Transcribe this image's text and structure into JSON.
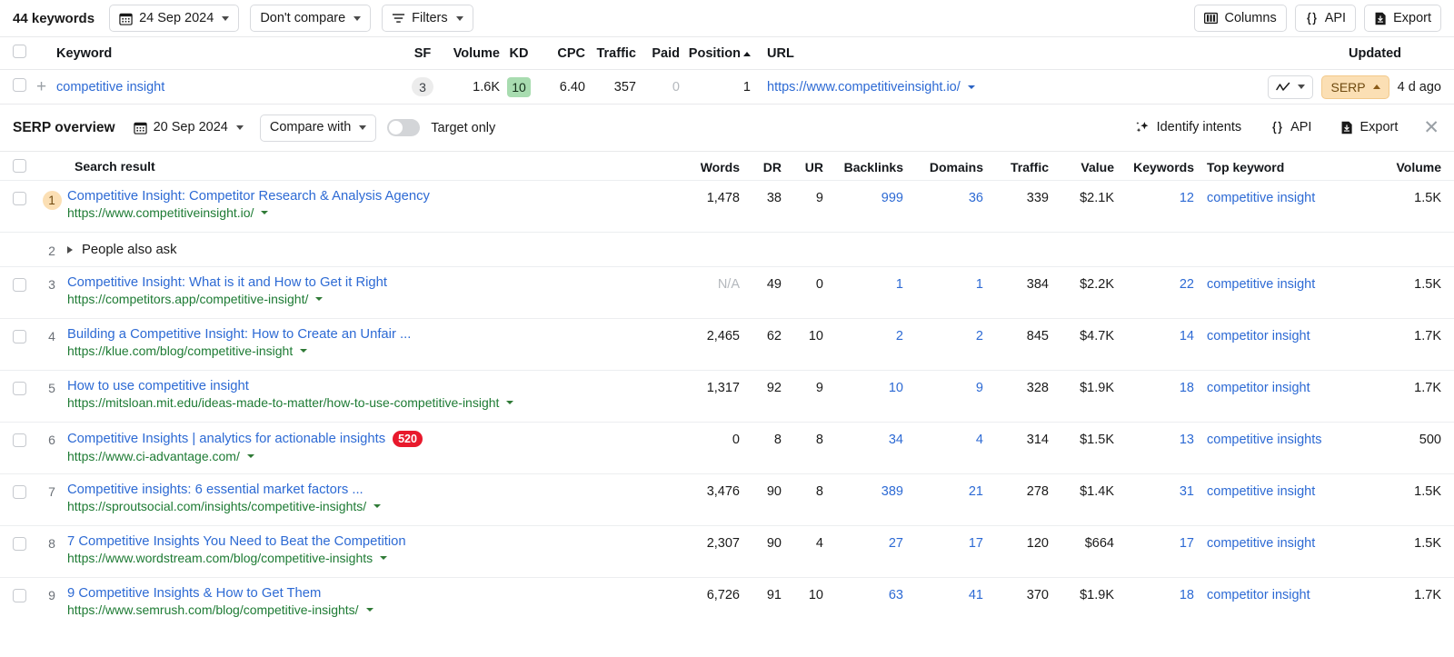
{
  "toolbar": {
    "keyword_count": "44 keywords",
    "date": "24 Sep 2024",
    "compare": "Don't compare",
    "filters": "Filters",
    "columns": "Columns",
    "api": "API",
    "export": "Export"
  },
  "keyword_table": {
    "headers": {
      "keyword": "Keyword",
      "sf": "SF",
      "volume": "Volume",
      "kd": "KD",
      "cpc": "CPC",
      "traffic": "Traffic",
      "paid": "Paid",
      "position": "Position",
      "url": "URL",
      "updated": "Updated"
    },
    "row": {
      "keyword": "competitive insight",
      "sf": "3",
      "volume": "1.6K",
      "kd": "10",
      "cpc": "6.40",
      "traffic": "357",
      "paid": "0",
      "position": "1",
      "url": "https://www.competitiveinsight.io/",
      "serp_label": "SERP",
      "updated": "4 d ago"
    }
  },
  "serp_overview": {
    "title": "SERP overview",
    "date": "20 Sep 2024",
    "compare_with": "Compare with",
    "target_only": "Target only",
    "identify_intents": "Identify intents",
    "api": "API",
    "export": "Export"
  },
  "serp_table": {
    "headers": {
      "search_result": "Search result",
      "words": "Words",
      "dr": "DR",
      "ur": "UR",
      "backlinks": "Backlinks",
      "domains": "Domains",
      "traffic": "Traffic",
      "value": "Value",
      "keywords": "Keywords",
      "top_keyword": "Top keyword",
      "volume": "Volume"
    },
    "rows": [
      {
        "type": "result",
        "rank": "1",
        "rank_highlight": true,
        "title": "Competitive Insight: Competitor Research & Analysis Agency",
        "url": "https://www.competitiveinsight.io/",
        "badge": "",
        "words": "1,478",
        "dr": "38",
        "ur": "9",
        "backlinks": "999",
        "domains": "36",
        "traffic": "339",
        "value": "$2.1K",
        "keywords": "12",
        "top_keyword": "competitive insight",
        "volume": "1.5K"
      },
      {
        "type": "paa",
        "rank": "2",
        "label": "People also ask"
      },
      {
        "type": "result",
        "rank": "3",
        "rank_highlight": false,
        "title": "Competitive Insight: What is it and How to Get it Right",
        "url": "https://competitors.app/competitive-insight/",
        "badge": "",
        "words": "N/A",
        "words_muted": true,
        "dr": "49",
        "ur": "0",
        "backlinks": "1",
        "domains": "1",
        "traffic": "384",
        "value": "$2.2K",
        "keywords": "22",
        "top_keyword": "competitive insight",
        "volume": "1.5K"
      },
      {
        "type": "result",
        "rank": "4",
        "rank_highlight": false,
        "title": "Building a Competitive Insight: How to Create an Unfair ...",
        "url": "https://klue.com/blog/competitive-insight",
        "badge": "",
        "words": "2,465",
        "dr": "62",
        "ur": "10",
        "backlinks": "2",
        "domains": "2",
        "traffic": "845",
        "value": "$4.7K",
        "keywords": "14",
        "top_keyword": "competitor insight",
        "volume": "1.7K"
      },
      {
        "type": "result",
        "rank": "5",
        "rank_highlight": false,
        "title": "How to use competitive insight",
        "url": "https://mitsloan.mit.edu/ideas-made-to-matter/how-to-use-competitive-insight",
        "badge": "",
        "words": "1,317",
        "dr": "92",
        "ur": "9",
        "backlinks": "10",
        "domains": "9",
        "traffic": "328",
        "value": "$1.9K",
        "keywords": "18",
        "top_keyword": "competitor insight",
        "volume": "1.7K"
      },
      {
        "type": "result",
        "rank": "6",
        "rank_highlight": false,
        "title": "Competitive Insights | analytics for actionable insights",
        "url": "https://www.ci-advantage.com/",
        "badge": "520",
        "words": "0",
        "dr": "8",
        "ur": "8",
        "backlinks": "34",
        "domains": "4",
        "traffic": "314",
        "value": "$1.5K",
        "keywords": "13",
        "top_keyword": "competitive insights",
        "volume": "500"
      },
      {
        "type": "result",
        "rank": "7",
        "rank_highlight": false,
        "title": "Competitive insights: 6 essential market factors ...",
        "url": "https://sproutsocial.com/insights/competitive-insights/",
        "badge": "",
        "words": "3,476",
        "dr": "90",
        "ur": "8",
        "backlinks": "389",
        "domains": "21",
        "traffic": "278",
        "value": "$1.4K",
        "keywords": "31",
        "top_keyword": "competitive insight",
        "volume": "1.5K"
      },
      {
        "type": "result",
        "rank": "8",
        "rank_highlight": false,
        "title": "7 Competitive Insights You Need to Beat the Competition",
        "url": "https://www.wordstream.com/blog/competitive-insights",
        "badge": "",
        "words": "2,307",
        "dr": "90",
        "ur": "4",
        "backlinks": "27",
        "domains": "17",
        "traffic": "120",
        "value": "$664",
        "keywords": "17",
        "top_keyword": "competitive insight",
        "volume": "1.5K"
      },
      {
        "type": "result",
        "rank": "9",
        "rank_highlight": false,
        "title": "9 Competitive Insights & How to Get Them",
        "url": "https://www.semrush.com/blog/competitive-insights/",
        "badge": "",
        "words": "6,726",
        "dr": "91",
        "ur": "10",
        "backlinks": "63",
        "domains": "41",
        "traffic": "370",
        "value": "$1.9K",
        "keywords": "18",
        "top_keyword": "competitor insight",
        "volume": "1.7K"
      }
    ]
  },
  "colors": {
    "link_blue": "#2d6ad4",
    "link_green": "#1e7b34",
    "serp_accent": "#fbdfb4",
    "kd_green": "#a8dcb0",
    "badge_red": "#e8192c"
  }
}
